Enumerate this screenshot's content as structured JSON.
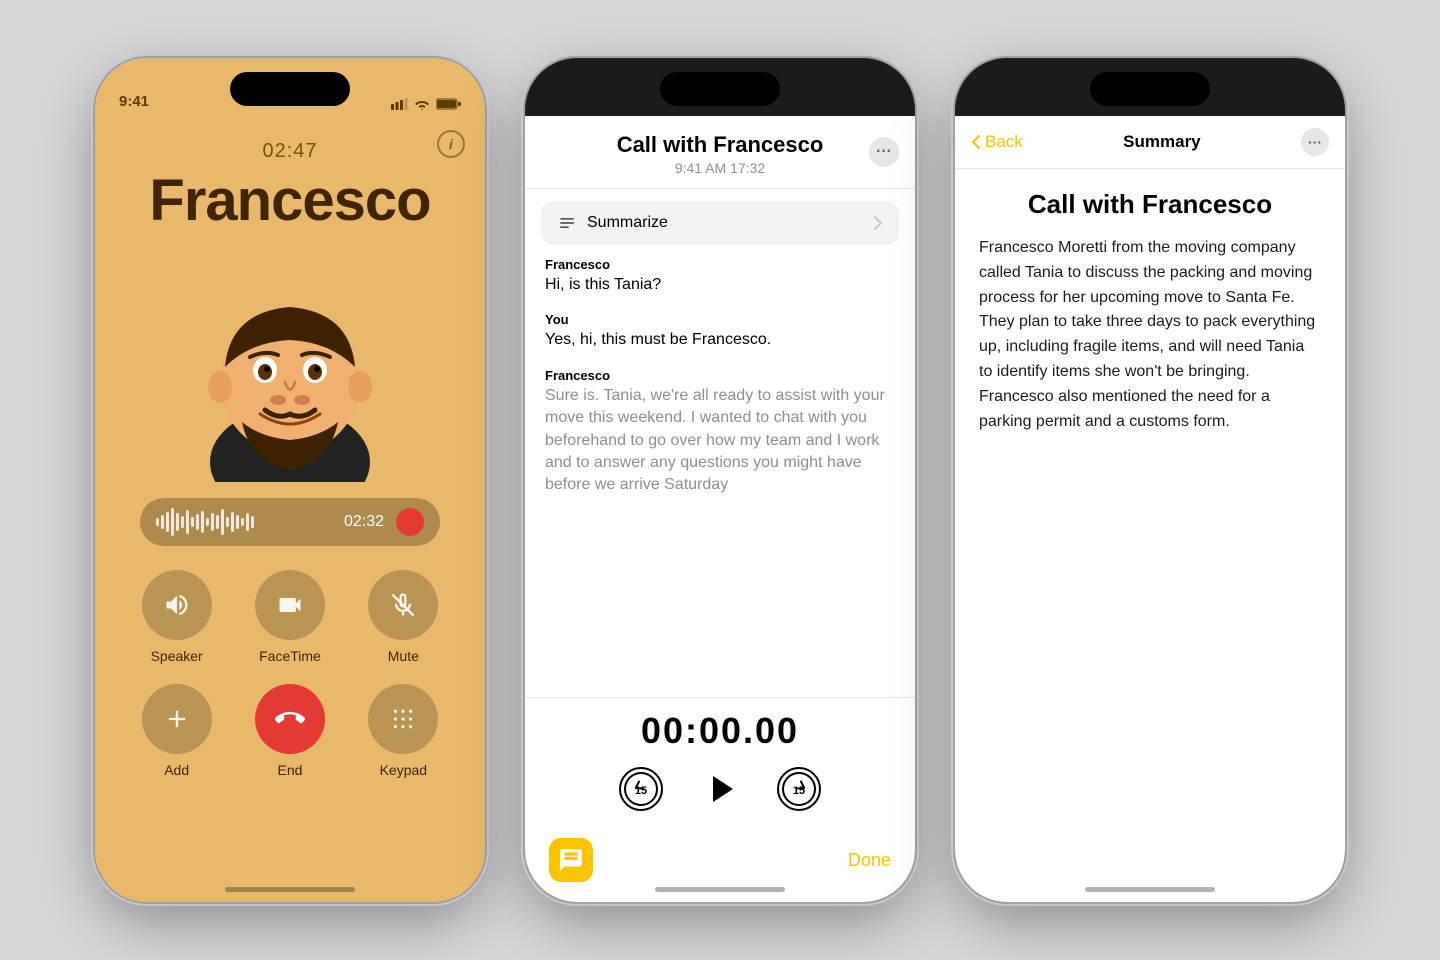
{
  "phone1": {
    "status_time": "9:41",
    "call_timer": "02:47",
    "caller_name": "Francesco",
    "waveform_time": "02:32",
    "info_icon": "i",
    "controls": [
      {
        "id": "speaker",
        "label": "Speaker",
        "icon": "🔊"
      },
      {
        "id": "facetime",
        "label": "FaceTime",
        "icon": "📷"
      },
      {
        "id": "mute",
        "label": "Mute",
        "icon": "🎤"
      },
      {
        "id": "add",
        "label": "Add",
        "icon": "👤"
      },
      {
        "id": "end",
        "label": "End",
        "icon": "📵"
      },
      {
        "id": "keypad",
        "label": "Keypad",
        "icon": "⌨️"
      }
    ]
  },
  "phone2": {
    "status_time": "9:41",
    "title": "Call with Francesco",
    "subtitle": "9:41 AM  17:32",
    "summarize_label": "Summarize",
    "messages": [
      {
        "speaker": "Francesco",
        "text": "Hi, is this Tania?",
        "faded": false
      },
      {
        "speaker": "You",
        "text": "Yes, hi, this must be Francesco.",
        "faded": false
      },
      {
        "speaker": "Francesco",
        "text": "Sure is. Tania, we're all ready to assist with your move this weekend. I wanted to chat with you beforehand to go over how my team and I work and to answer any questions you might have before we arrive Saturday",
        "faded": true
      }
    ],
    "playback_timer": "00:00.00",
    "done_label": "Done"
  },
  "phone3": {
    "status_time": "9:41",
    "back_label": "Back",
    "nav_title": "Summary",
    "call_title": "Call with Francesco",
    "summary_text": "Francesco Moretti from the moving company called Tania to discuss the packing and moving process for her upcoming move to Santa Fe. They plan to take three days to pack everything up, including fragile items, and will need Tania to identify items she won't be bringing. Francesco also mentioned the need for a parking permit and a customs form."
  },
  "colors": {
    "golden_bg": "#e8b96a",
    "accent_yellow": "#ffc200",
    "end_call_red": "#e53935",
    "dark_text": "#3d2600",
    "transcript_bg": "#fff"
  }
}
